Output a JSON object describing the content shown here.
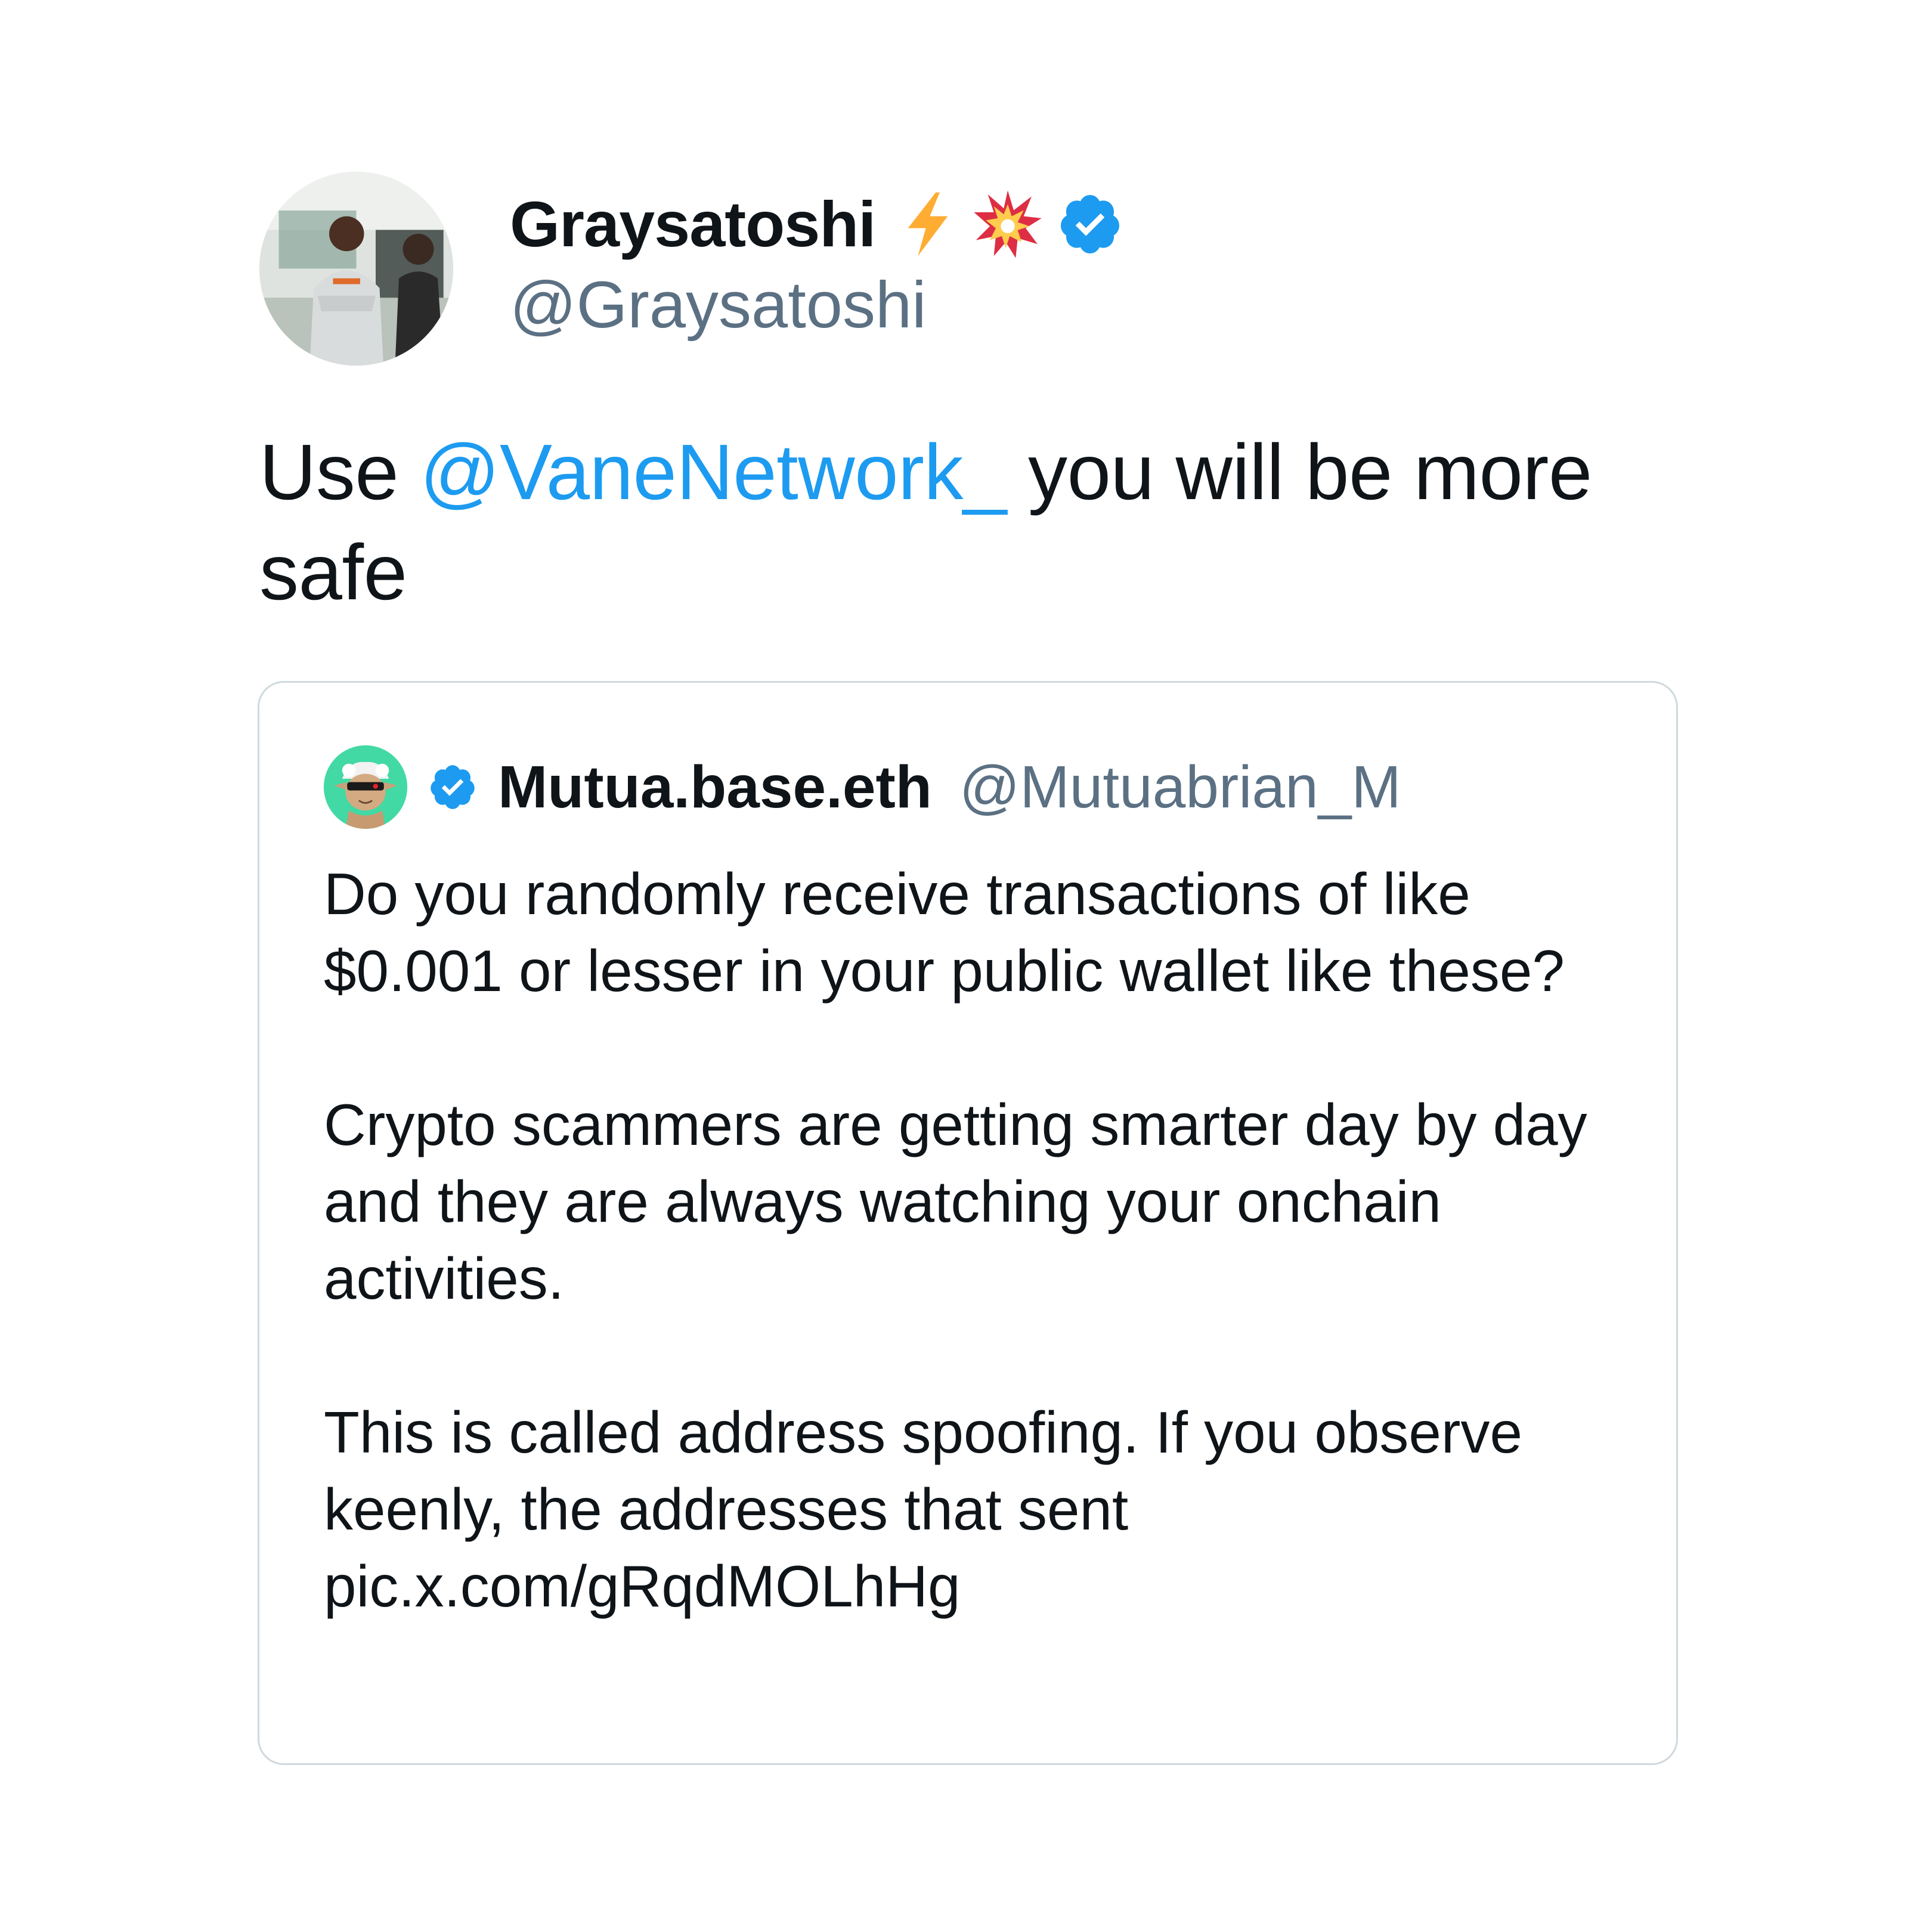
{
  "author": {
    "display_name": "Graysatoshi",
    "emojis": [
      "lightning-emoji",
      "collision-emoji"
    ],
    "verified": true,
    "handle": "@Graysatoshi",
    "avatar": "profile-photo"
  },
  "tweet": {
    "text_before": "Use ",
    "mention": "@VaneNetwork_",
    "text_after": " you will be more safe"
  },
  "quoted": {
    "display_name": "Mutua.base.eth",
    "handle": "@Mutuabrian_M",
    "verified": true,
    "avatar": "cartoon-goblin-sunglasses",
    "paragraphs": [
      "Do you randomly receive transactions of like $0.001 or lesser in your public wallet like these?",
      "Crypto scammers are getting smarter day by day and they are always watching your onchain activities.",
      "This is called address spoofing. If you observe keenly, the addresses that sent pic.x.com/gRqdMOLhHg"
    ]
  },
  "colors": {
    "link": "#1d9bf0",
    "secondary_text": "#5b7083",
    "border": "#cfd9de",
    "verified_badge": "#1d9bf0"
  }
}
